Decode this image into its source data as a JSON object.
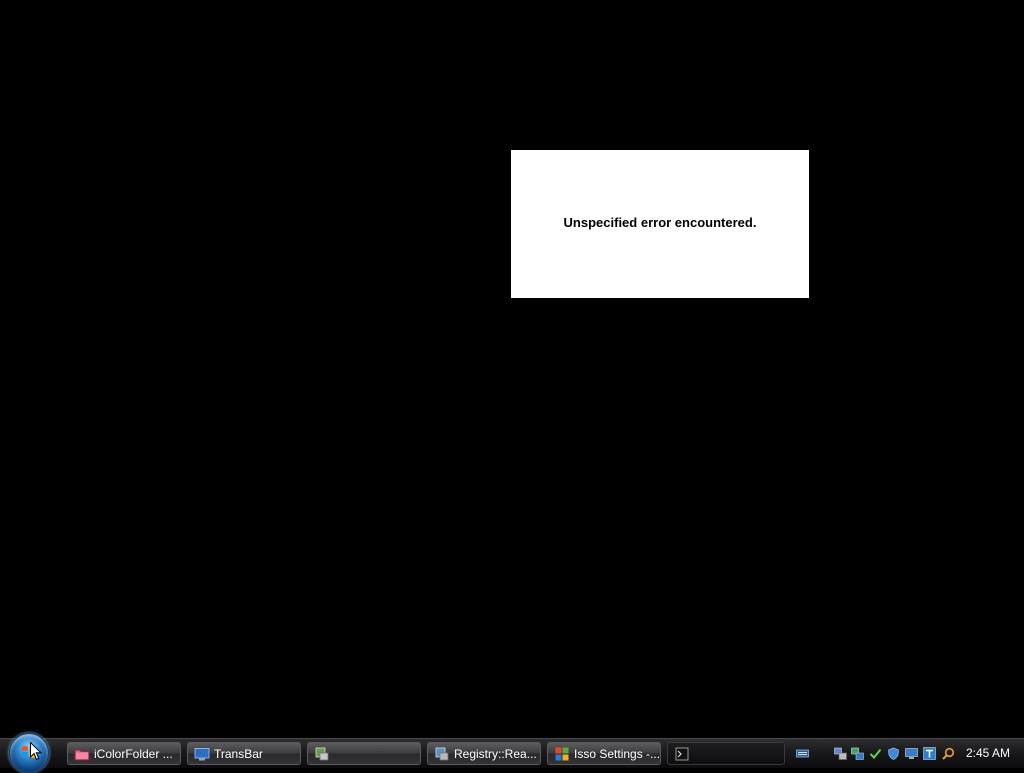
{
  "dialog": {
    "message": "Unspecified error encountered."
  },
  "taskbar": {
    "buttons": [
      {
        "label": "iColorFolder ...",
        "icon": "folder-icon"
      },
      {
        "label": "TransBar",
        "icon": "monitor-icon"
      },
      {
        "label": "",
        "icon": "app-icon"
      },
      {
        "label": "Registry::Rea...",
        "icon": "registry-icon"
      },
      {
        "label": "Isso Settings -...",
        "icon": "settings-icon"
      },
      {
        "label": "",
        "icon": "console-icon"
      }
    ],
    "tray_icons": [
      "keyboard-icon",
      "network-icon",
      "network-icon-2",
      "checkmark-icon",
      "shield-icon",
      "display-icon",
      "text-icon",
      "search-icon"
    ],
    "clock": "2:45 AM"
  },
  "colors": {
    "desktop": "#000000",
    "taskbar": "#1a1a1c",
    "dialog": "#ffffff"
  }
}
